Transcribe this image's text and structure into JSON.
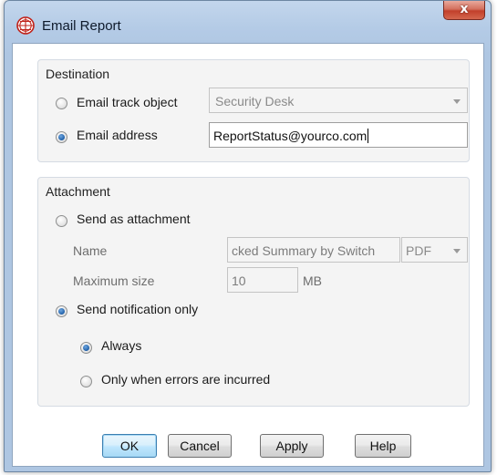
{
  "window": {
    "title": "Email Report",
    "close_symbol": "x"
  },
  "destination": {
    "group_label": "Destination",
    "email_track_object": {
      "label": "Email track object",
      "selected": false,
      "combo_value": "Security Desk"
    },
    "email_address": {
      "label": "Email address",
      "selected": true,
      "value": "ReportStatus@yourco.com"
    }
  },
  "attachment": {
    "group_label": "Attachment",
    "send_as_attachment": {
      "label": "Send as attachment",
      "selected": false
    },
    "name": {
      "label": "Name",
      "value": "cked Summary by Switch",
      "format": "PDF"
    },
    "maximum_size": {
      "label": "Maximum size",
      "value": "10",
      "unit": "MB"
    },
    "send_notification_only": {
      "label": "Send notification only",
      "selected": true
    },
    "always": {
      "label": "Always",
      "selected": true
    },
    "only_when_errors": {
      "label": "Only when errors are incurred",
      "selected": false
    }
  },
  "buttons": {
    "ok": "OK",
    "cancel": "Cancel",
    "apply": "Apply",
    "help": "Help"
  },
  "colors": {
    "title_bar": "#b4cbe6",
    "close_button": "#c2402b",
    "radio_selected": "#1f5fa8",
    "group_background": "#f4f4f4"
  },
  "icons": {
    "app_icon": "globe-grid-icon",
    "dropdown_arrow": "chevron-down-icon"
  }
}
